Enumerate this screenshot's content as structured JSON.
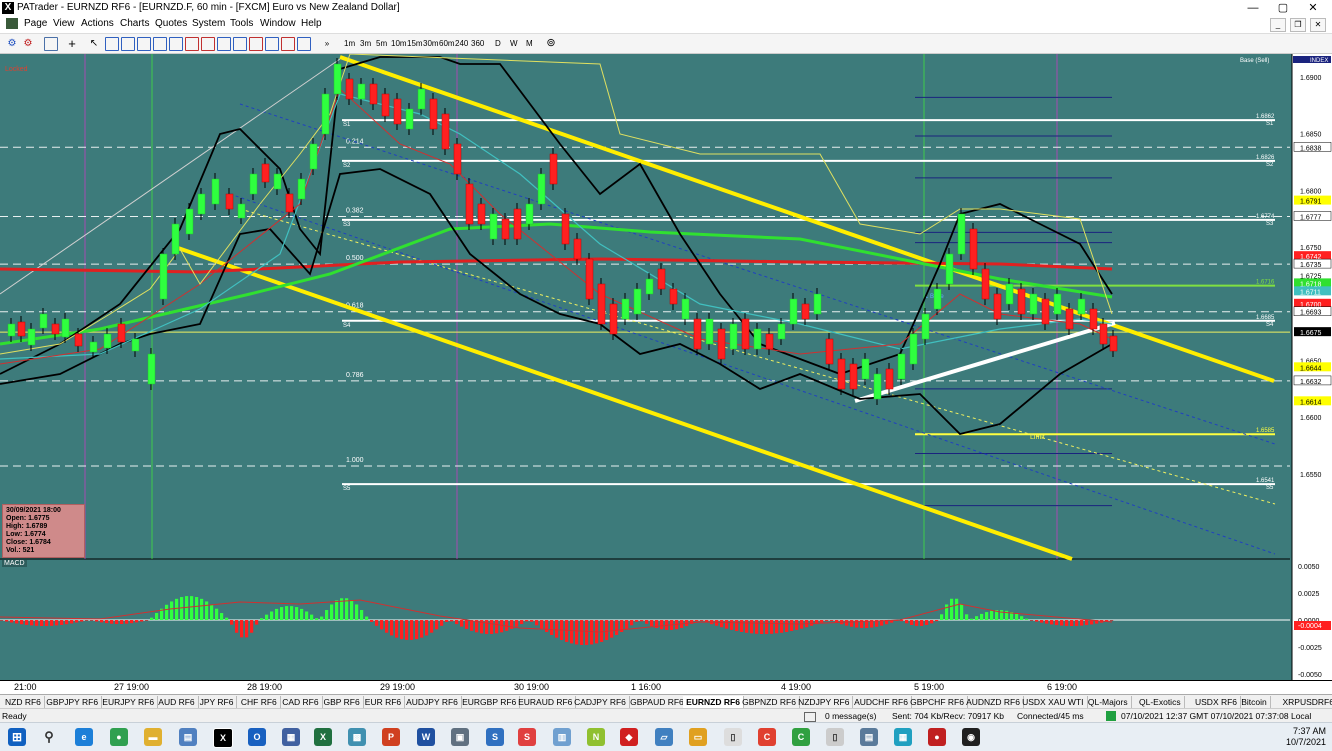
{
  "window": {
    "title": "PATrader - EURNZD RF6 - [EURNZD.F, 60 min - [FXCM] Euro vs New Zealand Dollar]",
    "minimize": "—",
    "maximize": "▢",
    "close": "✕"
  },
  "menu": [
    "Page",
    "View",
    "Actions",
    "Charts",
    "Quotes",
    "System",
    "Tools",
    "Window",
    "Help"
  ],
  "timeframes": [
    "1m",
    "3m",
    "5m",
    "10m",
    "15m",
    "30m",
    "60m",
    "240",
    "360",
    "D",
    "W",
    "M"
  ],
  "chart": {
    "locked_label": "Locked",
    "index_label": "INDEX",
    "base_label": "Base (Sell)",
    "price_axis": [
      {
        "label": "1.6900",
        "price": 1.69,
        "kind": "tick"
      },
      {
        "label": "1.6850",
        "price": 1.685,
        "kind": "tick"
      },
      {
        "label": "1.6838",
        "price": 1.6838,
        "kind": "white"
      },
      {
        "label": "1.6800",
        "price": 1.68,
        "kind": "tick"
      },
      {
        "label": "1.6791",
        "price": 1.6791,
        "kind": "yellow"
      },
      {
        "label": "1.6777",
        "price": 1.6777,
        "kind": "white"
      },
      {
        "label": "1.6750",
        "price": 1.675,
        "kind": "tick"
      },
      {
        "label": "1.6742",
        "price": 1.6742,
        "kind": "red"
      },
      {
        "label": "1.6735",
        "price": 1.6735,
        "kind": "white"
      },
      {
        "label": "1.6725",
        "price": 1.6725,
        "kind": "tick"
      },
      {
        "label": "1.6718",
        "price": 1.6718,
        "kind": "green"
      },
      {
        "label": "1.6711",
        "price": 1.6711,
        "kind": "cyan"
      },
      {
        "label": "1.6700",
        "price": 1.67,
        "kind": "red"
      },
      {
        "label": "1.6693",
        "price": 1.6693,
        "kind": "white"
      },
      {
        "label": "1.6675",
        "price": 1.6675,
        "kind": "current"
      },
      {
        "label": "1.6650",
        "price": 1.665,
        "kind": "tick"
      },
      {
        "label": "1.6644",
        "price": 1.6644,
        "kind": "yellow"
      },
      {
        "label": "1.6632",
        "price": 1.6632,
        "kind": "white"
      },
      {
        "label": "1.6614",
        "price": 1.6614,
        "kind": "yellow"
      },
      {
        "label": "1.6600",
        "price": 1.66,
        "kind": "tick"
      },
      {
        "label": "1.6550",
        "price": 1.655,
        "kind": "tick"
      }
    ],
    "fib_labels": [
      {
        "label": "0.214",
        "price": 1.6838
      },
      {
        "label": "0.382",
        "price": 1.6777
      },
      {
        "label": "0.500",
        "price": 1.6735
      },
      {
        "label": "0.618",
        "price": 1.6693
      },
      {
        "label": "0.786",
        "price": 1.6632
      },
      {
        "label": "1.000",
        "price": 1.6557
      }
    ],
    "pivot_labels": [
      {
        "label": "S1",
        "price": 1.6862
      },
      {
        "label": "S2",
        "price": 1.6826
      },
      {
        "label": "S3",
        "price": 1.6774
      },
      {
        "label": "S4",
        "price": 1.6685
      },
      {
        "label": "S5",
        "price": 1.6541
      }
    ],
    "right_pivots": [
      {
        "value": "1.6862",
        "tag": "S1",
        "price": 1.6862
      },
      {
        "value": "1.6826",
        "tag": "S2",
        "price": 1.6826
      },
      {
        "value": "1.6774",
        "tag": "S3",
        "price": 1.6774
      },
      {
        "value": "1.6685",
        "tag": "S4",
        "price": 1.6685
      },
      {
        "value": "1.6541",
        "tag": "S5",
        "price": 1.6541
      }
    ],
    "right_levels": [
      {
        "value": "1.6716",
        "price": 1.6716,
        "color": "#80e040"
      },
      {
        "value": "1.6585",
        "price": 1.6585,
        "color": "#ffff40"
      }
    ],
    "limit_label": "Limit",
    "limit_price": 1.6585,
    "box_label": "1 Base"
  },
  "macd": {
    "label": "MACD",
    "axis": [
      "0.0050",
      "0.0025",
      "0.0000",
      "-0.0025",
      "-0.0050"
    ],
    "current": "-0.0004"
  },
  "info": {
    "date": "30/09/2021 18:00",
    "open": "Open: 1.6775",
    "high": "High: 1.6789",
    "low": "Low: 1.6774",
    "close": "Close: 1.6784",
    "vol": "Vol.: 521"
  },
  "time_axis": [
    "21:00",
    "27 19:00",
    "28 19:00",
    "29 19:00",
    "30 19:00",
    "1 16:00",
    "4 19:00",
    "5 19:00",
    "6 19:00"
  ],
  "symbol_tabs": [
    "NZD RF6",
    "GBPJPY RF6",
    "EURJPY RF6",
    "AUD RF6",
    "JPY RF6",
    "CHF RF6",
    "CAD RF6",
    "GBP RF6",
    "EUR RF6",
    "AUDJPY RF6",
    "EURGBP RF6",
    "EURAUD RF6",
    "CADJPY RF6",
    "GBPAUD RF6",
    "EURNZD RF6",
    "GBPNZD RF6",
    "NZDJPY RF6",
    "AUDCHF RF6",
    "GBPCHF RF6",
    "AUDNZD RF6",
    "USDX XAU WTI",
    "QL-Majors",
    "QL-Exotics",
    "USDX RF6",
    "Bitcoin",
    "XRPUSDRF6"
  ],
  "active_tab": "EURNZD RF6",
  "status": {
    "ready": "Ready",
    "messages": "0 message(s)",
    "traffic": "Sent: 704 Kb/Recv: 70917 Kb",
    "connected": "Connected/45 ms",
    "datetime": "07/10/2021 12:37 GMT  07/10/2021 07:37:08 Local"
  },
  "taskbar": {
    "time": "7:37 AM",
    "date": "10/7/2021",
    "lang": "EN"
  }
}
